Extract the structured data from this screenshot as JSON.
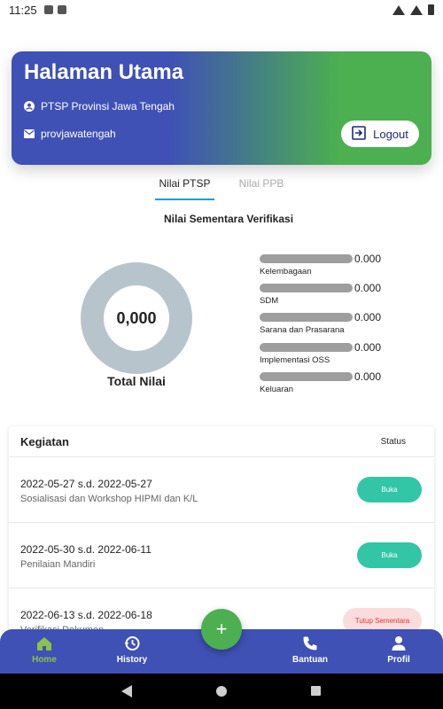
{
  "status_bar": {
    "time": "11:25"
  },
  "header": {
    "title": "Halaman Utama",
    "org": "PTSP Provinsi Jawa Tengah",
    "username": "provjawatengah",
    "logout_label": "Logout"
  },
  "tabs": [
    {
      "label": "Nilai PTSP",
      "active": true
    },
    {
      "label": "Nilai PPB",
      "active": false
    }
  ],
  "score": {
    "section_title": "Nilai Sementara Verifikasi",
    "total_value": "0,000",
    "total_label": "Total Nilai",
    "metrics": [
      {
        "value": "0.000",
        "label": "Kelembagaan"
      },
      {
        "value": "0.000",
        "label": "SDM"
      },
      {
        "value": "0.000",
        "label": "Sarana dan Prasarana"
      },
      {
        "value": "0.000",
        "label": "Implementasi OSS"
      },
      {
        "value": "0.000",
        "label": "Keluaran"
      }
    ]
  },
  "activities": {
    "title": "Kegiatan",
    "status_header": "Status",
    "rows": [
      {
        "date": "2022-05-27 s.d. 2022-05-27",
        "name": "Sosialisasi dan Workshop HIPMI dan K/L",
        "status": "Buka"
      },
      {
        "date": "2022-05-30 s.d. 2022-06-11",
        "name": "Penilaian Mandiri",
        "status": "Buka"
      },
      {
        "date": "2022-06-13 s.d. 2022-06-18",
        "name": "Verifikasi Dokumen",
        "status": "Tutup Sementara"
      }
    ]
  },
  "fab": {
    "label": "+"
  },
  "bottom_nav": [
    {
      "label": "Home",
      "icon": "home-icon",
      "active": true
    },
    {
      "label": "History",
      "icon": "history-icon",
      "active": false
    },
    {
      "label": "Bantuan",
      "icon": "phone-icon",
      "active": false
    },
    {
      "label": "Profil",
      "icon": "person-icon",
      "active": false
    }
  ],
  "colors": {
    "primary": "#3f51b5",
    "accent_green": "#4caf50",
    "open_badge": "#32c6a6",
    "closed_badge_bg": "#fbdcdc",
    "closed_badge_text": "#e53935"
  }
}
